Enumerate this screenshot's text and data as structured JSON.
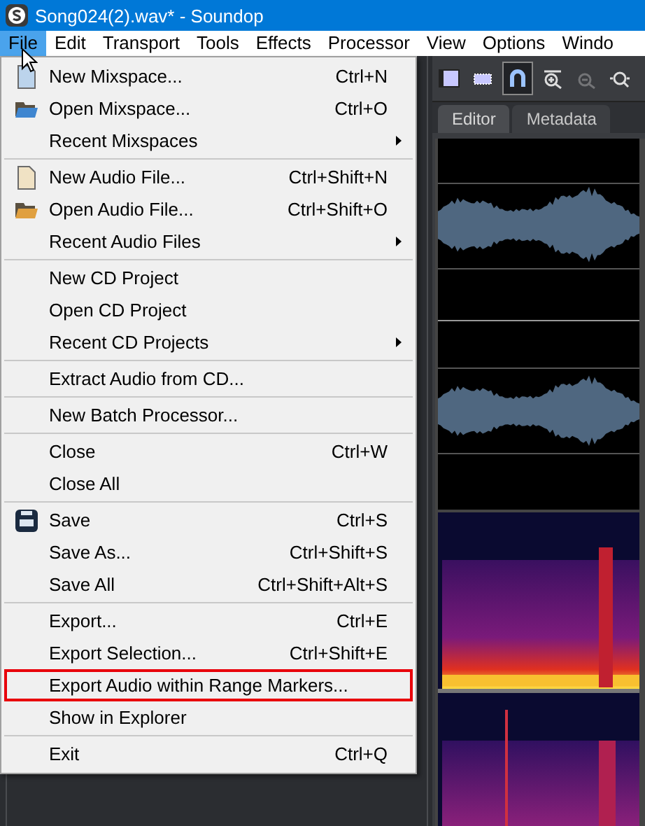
{
  "window": {
    "title": "Song024(2).wav* - Soundop"
  },
  "menu_bar": [
    {
      "label": "File",
      "selected": true
    },
    {
      "label": "Edit",
      "selected": false
    },
    {
      "label": "Transport",
      "selected": false
    },
    {
      "label": "Tools",
      "selected": false
    },
    {
      "label": "Effects",
      "selected": false
    },
    {
      "label": "Processor",
      "selected": false
    },
    {
      "label": "View",
      "selected": false
    },
    {
      "label": "Options",
      "selected": false
    },
    {
      "label": "Windo",
      "selected": false
    }
  ],
  "toolbar": [
    {
      "kind": "range-select",
      "on": false,
      "disabled": false
    },
    {
      "kind": "dotted-select",
      "on": false,
      "disabled": false
    },
    {
      "kind": "magnet",
      "on": true,
      "disabled": false
    },
    {
      "kind": "zoom-in",
      "on": false,
      "disabled": false
    },
    {
      "kind": "zoom-out",
      "on": false,
      "disabled": true
    },
    {
      "kind": "zoom-fit",
      "on": false,
      "disabled": false
    }
  ],
  "tabs": [
    {
      "label": "Editor",
      "selected": true
    },
    {
      "label": "Metadata",
      "selected": false
    }
  ],
  "file_menu": {
    "groups": [
      {
        "items": [
          {
            "kind": "page",
            "color": "#bcd4ec",
            "label": "New Mixspace...",
            "shortcut": "Ctrl+N",
            "submenu": false,
            "highlighted": false
          },
          {
            "kind": "folder",
            "color": "#3f86d0",
            "label": "Open Mixspace...",
            "shortcut": "Ctrl+O",
            "submenu": false,
            "highlighted": false
          },
          {
            "kind": "text",
            "label": "Recent Mixspaces",
            "submenu": true,
            "highlighted": false
          }
        ]
      },
      {
        "items": [
          {
            "kind": "page",
            "color": "#f0e2c4",
            "label": "New Audio File...",
            "shortcut": "Ctrl+Shift+N",
            "submenu": false,
            "highlighted": false
          },
          {
            "kind": "folder",
            "color": "#e0a040",
            "label": "Open Audio File...",
            "shortcut": "Ctrl+Shift+O",
            "submenu": false,
            "highlighted": false
          },
          {
            "kind": "text",
            "label": "Recent Audio Files",
            "submenu": true,
            "highlighted": false
          }
        ]
      },
      {
        "items": [
          {
            "kind": "text",
            "label": "New CD Project",
            "submenu": false,
            "highlighted": false
          },
          {
            "kind": "text",
            "label": "Open CD Project",
            "submenu": false,
            "highlighted": false
          },
          {
            "kind": "text",
            "label": "Recent CD Projects",
            "submenu": true,
            "highlighted": false
          }
        ]
      },
      {
        "items": [
          {
            "kind": "text",
            "label": "Extract Audio from CD...",
            "submenu": false,
            "highlighted": false
          }
        ]
      },
      {
        "items": [
          {
            "kind": "text",
            "label": "New Batch Processor...",
            "submenu": false,
            "highlighted": false
          }
        ]
      },
      {
        "items": [
          {
            "kind": "text",
            "label": "Close",
            "shortcut": "Ctrl+W",
            "submenu": false,
            "highlighted": false
          },
          {
            "kind": "text",
            "label": "Close All",
            "submenu": false,
            "highlighted": false
          }
        ]
      },
      {
        "items": [
          {
            "kind": "disk",
            "label": "Save",
            "shortcut": "Ctrl+S",
            "submenu": false,
            "highlighted": false
          },
          {
            "kind": "text",
            "label": "Save As...",
            "shortcut": "Ctrl+Shift+S",
            "submenu": false,
            "highlighted": false
          },
          {
            "kind": "text",
            "label": "Save All",
            "shortcut": "Ctrl+Shift+Alt+S",
            "submenu": false,
            "highlighted": false
          }
        ]
      },
      {
        "items": [
          {
            "kind": "text",
            "label": "Export...",
            "shortcut": "Ctrl+E",
            "submenu": false,
            "highlighted": false
          },
          {
            "kind": "text",
            "label": "Export Selection...",
            "shortcut": "Ctrl+Shift+E",
            "submenu": false,
            "highlighted": false
          },
          {
            "kind": "text",
            "label": "Export Audio within Range Markers...",
            "submenu": false,
            "highlighted": true
          },
          {
            "kind": "text",
            "label": "Show in Explorer",
            "submenu": false,
            "highlighted": false
          }
        ]
      },
      {
        "items": [
          {
            "kind": "text",
            "label": "Exit",
            "shortcut": "Ctrl+Q",
            "submenu": false,
            "highlighted": false
          }
        ]
      }
    ]
  }
}
